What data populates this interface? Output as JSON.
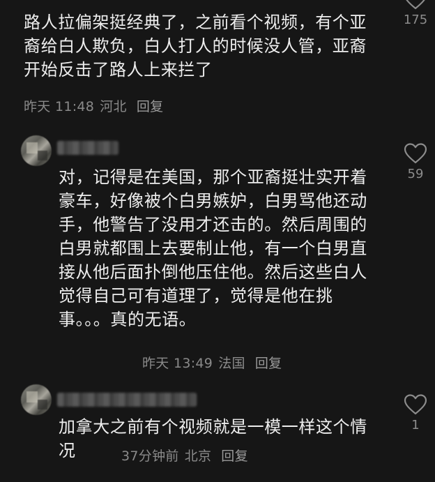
{
  "comments": [
    {
      "text": "路人拉偏架挺经典了，之前看个视频，有个亚裔给白人欺负，白人打人的时候没人管，亚裔开始反击了路人上来拦了",
      "time": "昨天 11:48",
      "location": "河北",
      "reply_label": "回复",
      "likes": "175"
    },
    {
      "text": "对，记得是在美国，那个亚裔挺壮实开着豪车，好像被个白男嫉妒，白男骂他还动手，他警告了没用才还击的。然后周围的白男就都围上去要制止他，有一个白男直接从他后面扑倒他压住他。然后这些白人觉得自己可有道理了，觉得是他在挑事。。。真的无语。",
      "time": "昨天 13:49",
      "location": "法国",
      "reply_label": "回复",
      "likes": "59"
    },
    {
      "text": "加拿大之前有个视频就是一模一样这个情况",
      "time": "37分钟前",
      "location": "北京",
      "reply_label": "回复",
      "likes": "1"
    }
  ],
  "icons": {
    "like": "heart-outline-icon"
  },
  "colors": {
    "background": "#161616",
    "text": "#eeeeee",
    "meta": "#8a8a8a"
  }
}
